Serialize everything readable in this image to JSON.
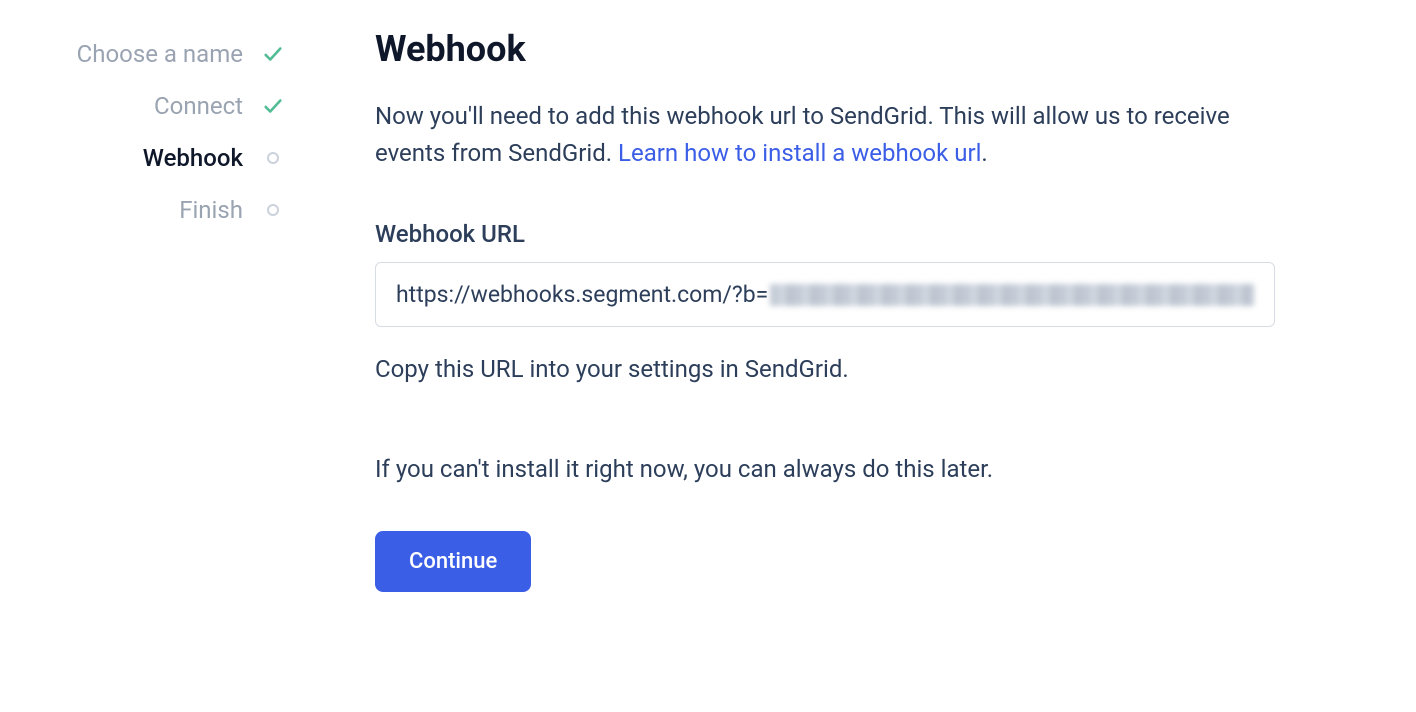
{
  "sidebar": {
    "steps": [
      {
        "label": "Choose a name",
        "state": "done"
      },
      {
        "label": "Connect",
        "state": "done"
      },
      {
        "label": "Webhook",
        "state": "current"
      },
      {
        "label": "Finish",
        "state": "pending"
      }
    ]
  },
  "main": {
    "title": "Webhook",
    "description_part1": "Now you'll need to add this webhook url to SendGrid. This will allow us to receive events from SendGrid. ",
    "description_link": "Learn how to install a webhook url",
    "description_part2": ".",
    "url_label": "Webhook URL",
    "url_visible": "https://webhooks.segment.com/?b=",
    "copy_help": "Copy this URL into your settings in SendGrid.",
    "later_text": "If you can't install it right now, you can always do this later.",
    "continue_label": "Continue"
  }
}
